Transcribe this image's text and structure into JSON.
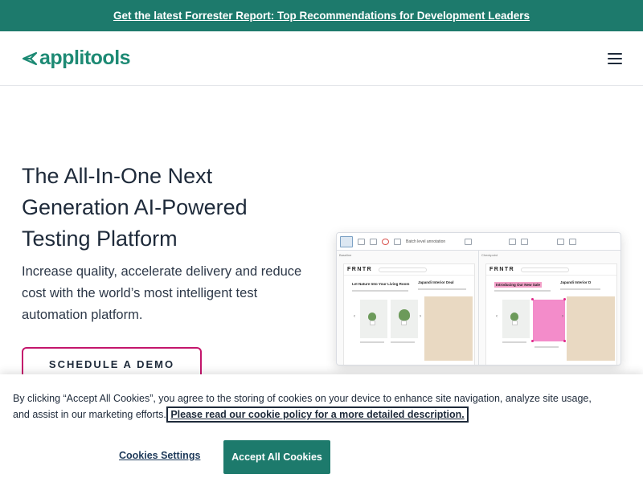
{
  "banner": {
    "link_text": "Get the latest Forrester Report: Top Recommendations for Development Leaders"
  },
  "header": {
    "logo_text": "applitools",
    "menu_icon": "hamburger-menu-icon"
  },
  "hero": {
    "title": "The All-In-One Next Generation AI-Powered Testing Platform",
    "subtitle": "Increase quality, accelerate delivery and reduce cost with the world’s most intelligent test automation platform.",
    "cta_label": "SCHEDULE A DEMO"
  },
  "screenshot": {
    "toolbar_label": "Batch level annotation",
    "left_pane": {
      "header": "Baseline",
      "shop_logo": "FRNTR",
      "headline": "Let Nature Into Your Living Room",
      "headline2": "Japandi Interior Deal"
    },
    "right_pane": {
      "header": "Checkpoint",
      "shop_logo": "FRNTR",
      "headline": "Introducing Our New Sale",
      "headline2": "Japandi Interior D"
    }
  },
  "cookie_banner": {
    "text": "By clicking “Accept All Cookies”, you agree to the storing of cookies on your device to enhance site navigation, analyze site usage, and assist in our marketing efforts.",
    "policy_link": "Please read our cookie policy for a more detailed description.",
    "settings_label": "Cookies Settings",
    "accept_label": "Accept All Cookies"
  },
  "colors": {
    "brand_green": "#1d8a74",
    "banner_teal": "#1d7a6c",
    "cta_border": "#c4166c"
  }
}
